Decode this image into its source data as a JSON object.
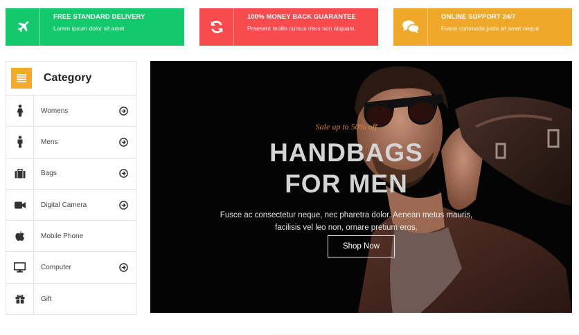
{
  "features": [
    {
      "title": "FREE STANDARD DELIVERY",
      "subtitle": "Lorem ipsum dolor sit amet",
      "icon": "airplane-icon",
      "color": "#13c86d"
    },
    {
      "title": "100% MONEY BACK GUARANTEE",
      "subtitle": "Praesent mollis cursus risus non aliquam.",
      "icon": "refresh-icon",
      "color": "#f84b4e"
    },
    {
      "title": "ONLINE SUPPORT 24/7",
      "subtitle": "Fusce commodo justo sit amet neque",
      "icon": "chat-bubbles-icon",
      "color": "#f0a82a"
    }
  ],
  "sidebar": {
    "title": "Category",
    "header_icon": "list-icon",
    "items": [
      {
        "label": "Womens",
        "icon": "woman-icon",
        "has_arrow": true
      },
      {
        "label": "Mens",
        "icon": "man-icon",
        "has_arrow": true
      },
      {
        "label": "Bags",
        "icon": "briefcase-icon",
        "has_arrow": true
      },
      {
        "label": "Digital Camera",
        "icon": "video-camera-icon",
        "has_arrow": true
      },
      {
        "label": "Mobile Phone",
        "icon": "apple-icon",
        "has_arrow": false
      },
      {
        "label": "Computer",
        "icon": "desktop-icon",
        "has_arrow": true
      },
      {
        "label": "Gift",
        "icon": "gift-icon",
        "has_arrow": false
      }
    ]
  },
  "hero": {
    "tagline": "Sale up to 50% off",
    "title_line1": "HANDBAGS",
    "title_line2": "FOR MEN",
    "description": "Fusce ac consectetur neque, nec pharetra dolor. Aenean metus mauris, facilisis vel leo non, ornare pretium eros.",
    "button_label": "Shop Now"
  },
  "colors": {
    "green": "#13c86d",
    "red": "#f84b4e",
    "orange": "#f0a82a",
    "category_accent": "#f7a92a"
  }
}
